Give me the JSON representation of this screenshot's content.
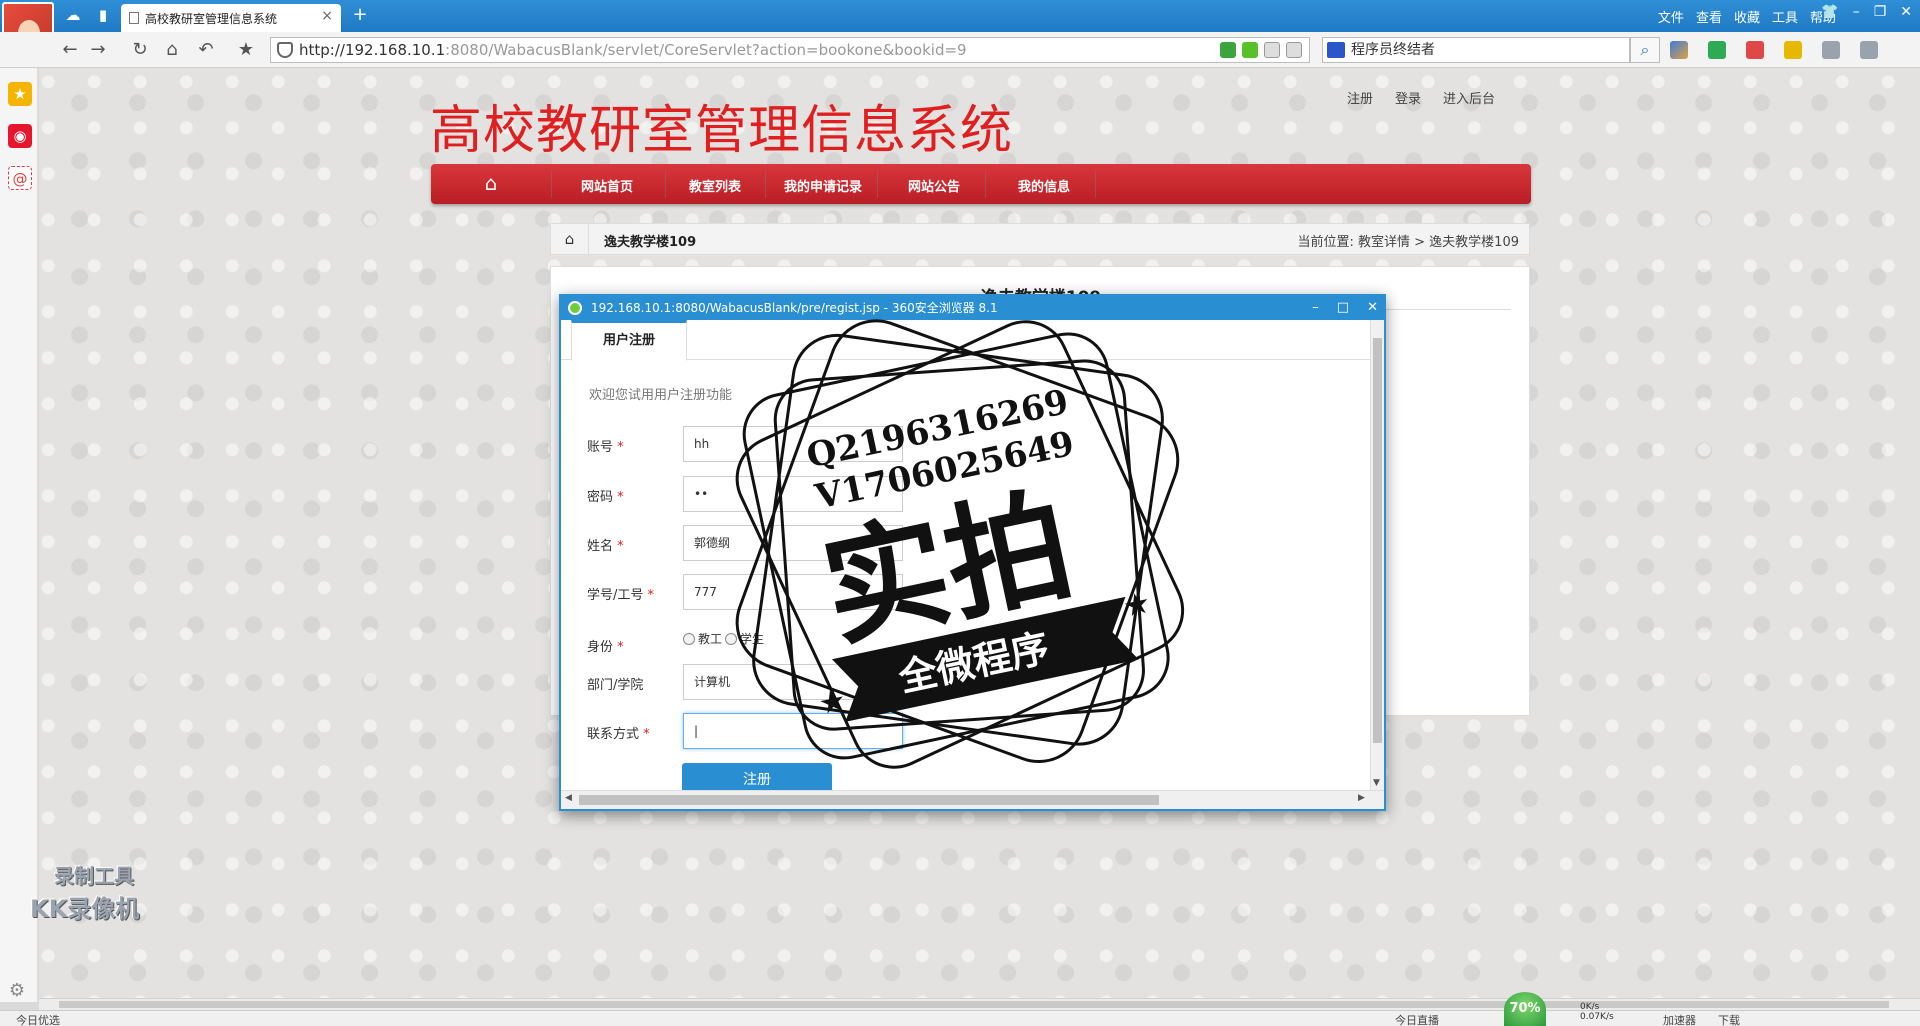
{
  "browser": {
    "tab_title": "高校教研室管理信息系统",
    "url_host": "http://192.168.10.1",
    "url_path": ":8080/WabacusBlank/servlet/CoreServlet?action=bookone&bookid=9",
    "search_value": "程序员终结者",
    "menu": [
      "文件",
      "查看",
      "收藏",
      "工具",
      "帮助"
    ]
  },
  "site": {
    "title": "高校教研室管理信息系统",
    "top_links": [
      "注册",
      "登录",
      "进入后台"
    ],
    "nav": [
      "网站首页",
      "教室列表",
      "我的申请记录",
      "网站公告",
      "我的信息"
    ]
  },
  "breadcrumb": {
    "title": "逸夫教学楼109",
    "location_prefix": "当前位置: 教室详情",
    "separator": ">",
    "location_current": "逸夫教学楼109"
  },
  "content": {
    "title": "逸夫教学楼109"
  },
  "popup": {
    "window_title": "192.168.10.1:8080/WabacusBlank/pre/regist.jsp - 360安全浏览器 8.1",
    "tab": "用户注册",
    "welcome": "欢迎您试用用户注册功能",
    "fields": {
      "account": {
        "label": "账号",
        "value": "hh"
      },
      "password": {
        "label": "密码",
        "value": "••"
      },
      "name": {
        "label": "姓名",
        "value": "郭德纲"
      },
      "student_id": {
        "label": "学号/工号",
        "value": "777"
      },
      "identity": {
        "label": "身份",
        "options": [
          "教工",
          "学生"
        ]
      },
      "department": {
        "label": "部门/学院",
        "value": "计算机"
      },
      "contact": {
        "label": "联系方式",
        "value": "|"
      }
    },
    "required_mark": "*",
    "submit": "注册"
  },
  "watermark": {
    "line1": "Q2196316269",
    "line2": "V1706025649",
    "main": "实拍",
    "banner": "全微程序"
  },
  "recorder": {
    "line1": "录制工具",
    "line2": "KK录像机"
  },
  "status": {
    "left": "今日优选",
    "speed_percent": "70%",
    "net_up": "0K/s",
    "net_down": "0.07K/s",
    "right_items": [
      "今日直播",
      "加速器",
      "下载"
    ]
  }
}
